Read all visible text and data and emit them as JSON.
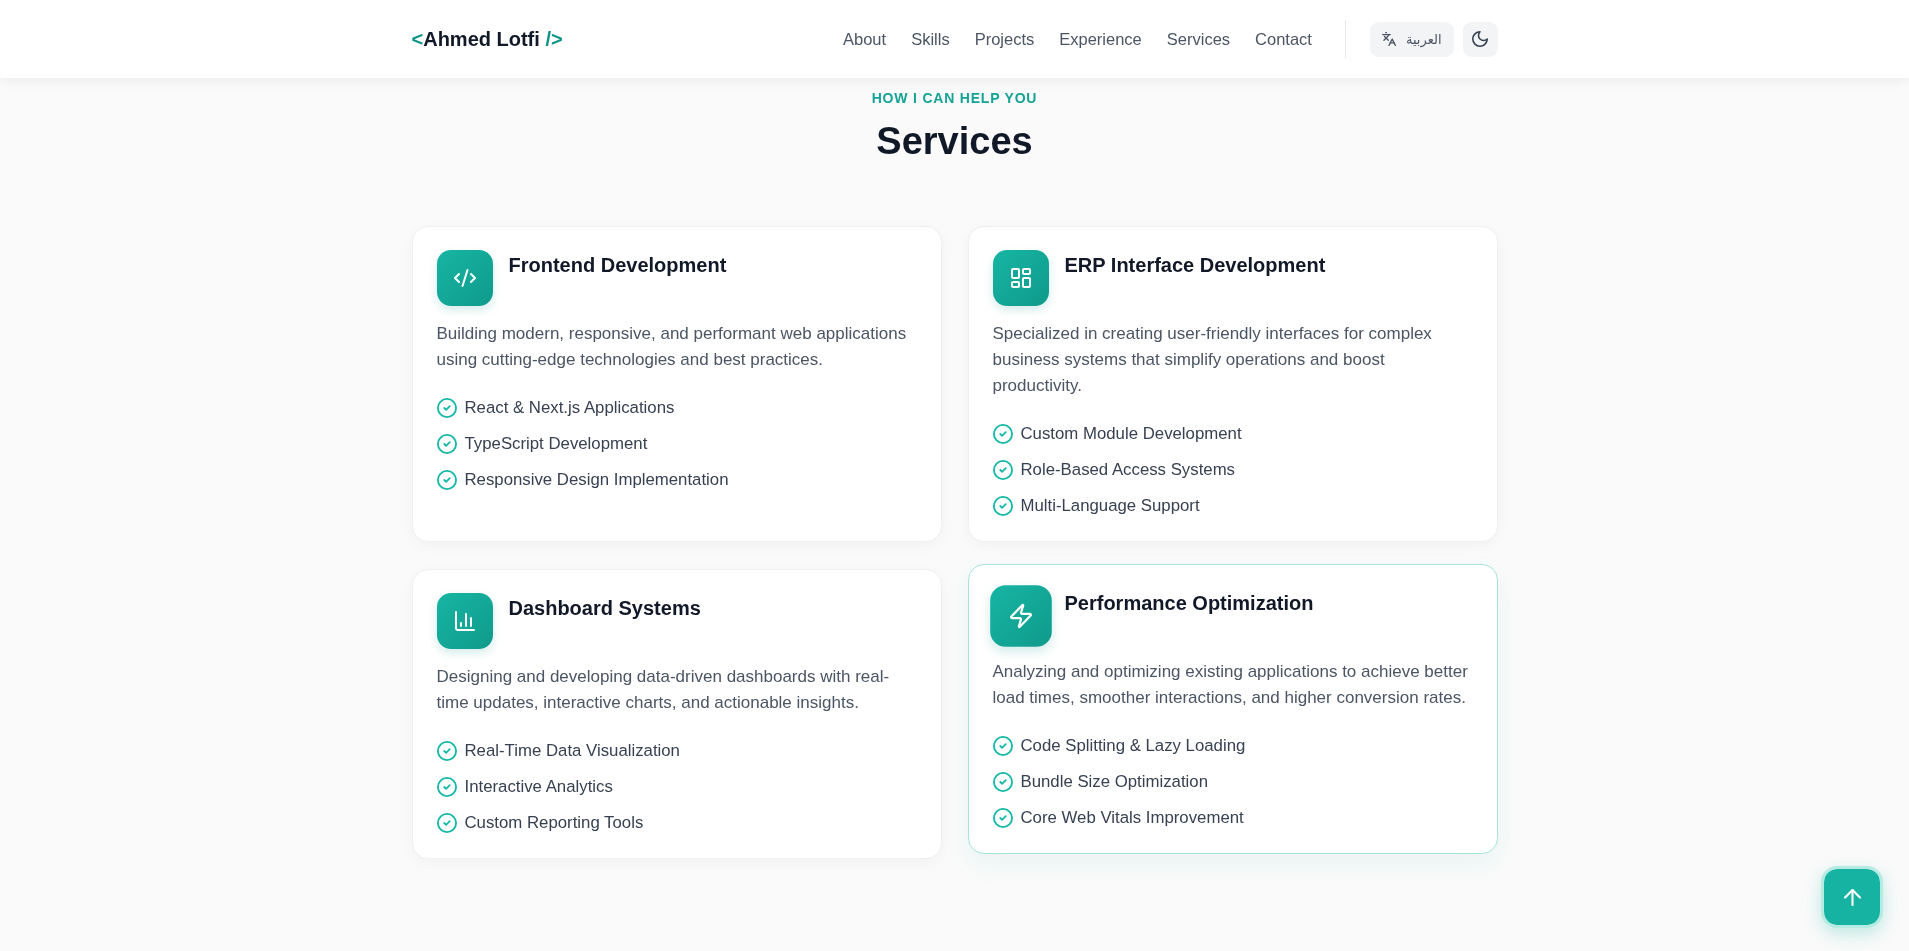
{
  "header": {
    "logo": {
      "open_tag": "<",
      "name": "Ahmed Lotfi",
      "close_tag": "/>"
    },
    "nav": [
      "About",
      "Skills",
      "Projects",
      "Experience",
      "Services",
      "Contact"
    ],
    "language_button": {
      "label": "العربية"
    }
  },
  "section": {
    "eyebrow": "HOW I CAN HELP YOU",
    "title": "Services"
  },
  "services": [
    {
      "kind": "code",
      "title": "Frontend Development",
      "description": "Building modern, responsive, and performant web applications using cutting-edge technologies and best practices.",
      "features": [
        "React & Next.js Applications",
        "TypeScript Development",
        "Responsive Design Implementation"
      ],
      "hovered": false
    },
    {
      "kind": "layout",
      "title": "ERP Interface Development",
      "description": "Specialized in creating user-friendly interfaces for complex business systems that simplify operations and boost productivity.",
      "features": [
        "Custom Module Development",
        "Role-Based Access Systems",
        "Multi-Language Support"
      ],
      "hovered": false
    },
    {
      "kind": "chart",
      "title": "Dashboard Systems",
      "description": "Designing and developing data-driven dashboards with real-time updates, interactive charts, and actionable insights.",
      "features": [
        "Real-Time Data Visualization",
        "Interactive Analytics",
        "Custom Reporting Tools"
      ],
      "hovered": false
    },
    {
      "kind": "bolt",
      "title": "Performance Optimization",
      "description": "Analyzing and optimizing existing applications to achieve better load times, smoother interactions, and higher conversion rates.",
      "features": [
        "Code Splitting & Lazy Loading",
        "Bundle Size Optimization",
        "Core Web Vitals Improvement"
      ],
      "hovered": true
    }
  ]
}
